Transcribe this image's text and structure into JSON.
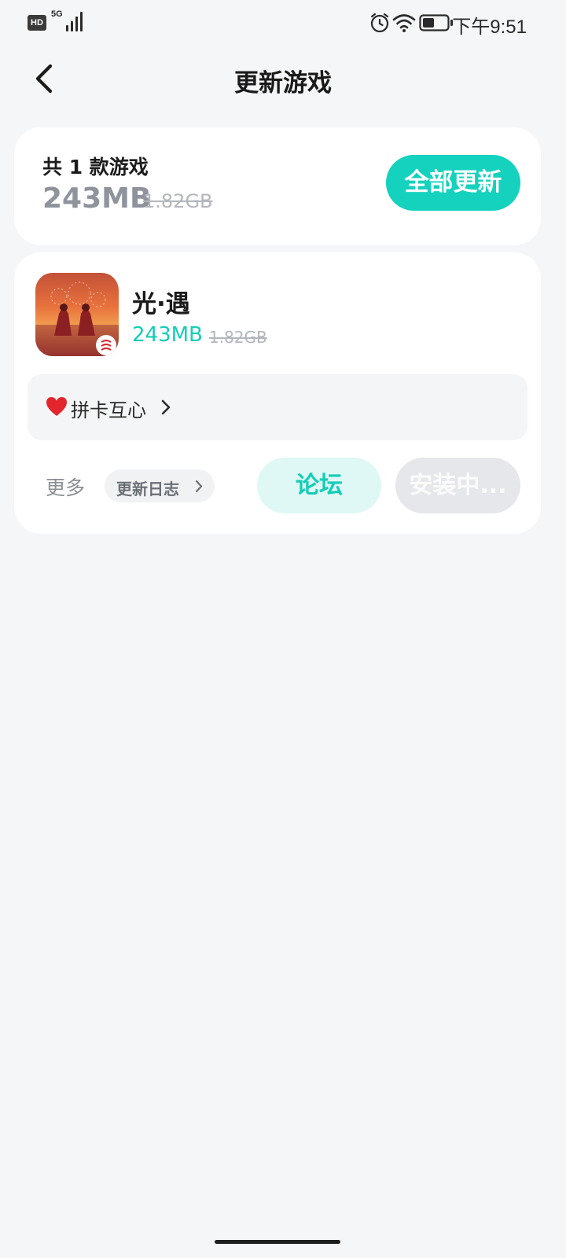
{
  "status_bar": {
    "hd": "HD",
    "network": "5G",
    "time": "下午9:51",
    "icons": [
      "signal-icon",
      "alarm-icon",
      "wifi-icon",
      "battery-icon"
    ],
    "battery_level": 0.4
  },
  "header": {
    "title": "更新游戏",
    "back_icon": "back-chevron-icon"
  },
  "summary": {
    "count_text": "共 1 款游戏",
    "download_size": "243MB",
    "full_size": "1.82GB",
    "update_all_label": "全部更新"
  },
  "games": [
    {
      "name": "光·遇",
      "download_size": "243MB",
      "full_size": "1.82GB",
      "promo_emoji": "❤️",
      "promo_label": "拼卡互心",
      "more_label": "更多",
      "changelog_label": "更新日志",
      "forum_label": "论坛",
      "status_label": "安装中..."
    }
  ],
  "colors": {
    "accent": "#14d2bd",
    "accent_text": "#14cdb7",
    "accent_soft": "#dff8f5",
    "disabled": "#e5e7ea",
    "background": "#f5f6f8"
  }
}
